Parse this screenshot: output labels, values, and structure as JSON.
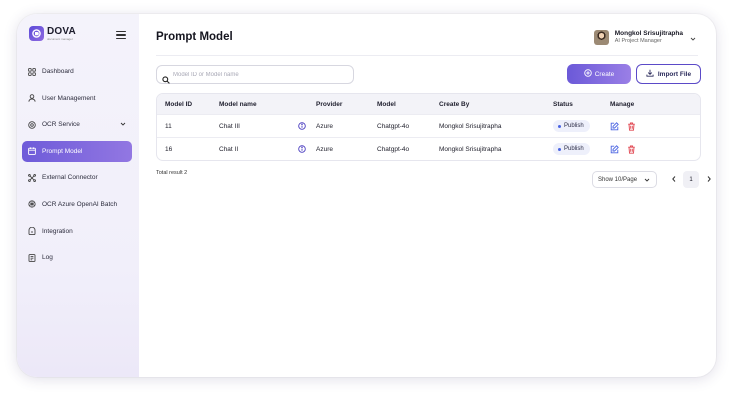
{
  "brand": {
    "name": "DOVA",
    "tagline": "document manager"
  },
  "sidebar": {
    "items": [
      {
        "label": "Dashboard",
        "icon": "grid-icon",
        "active": false
      },
      {
        "label": "User Management",
        "icon": "user-icon",
        "active": false
      },
      {
        "label": "OCR Service",
        "icon": "target-icon",
        "active": false,
        "has_submenu": true
      },
      {
        "label": "Prompt Model",
        "icon": "calendar-icon",
        "active": true
      },
      {
        "label": "External Connector",
        "icon": "connector-icon",
        "active": false
      },
      {
        "label": "OCR Azure OpenAI Batch",
        "icon": "openai-icon",
        "active": false
      },
      {
        "label": "Integration",
        "icon": "integration-icon",
        "active": false
      },
      {
        "label": "Log",
        "icon": "log-icon",
        "active": false
      }
    ]
  },
  "header": {
    "title": "Prompt Model",
    "user": {
      "name": "Mongkol Srisujitrapha",
      "role": "AI Project Manager"
    }
  },
  "toolbar": {
    "search_placeholder": "Model ID or Model name",
    "create_label": "Create",
    "import_label": "Import File"
  },
  "table": {
    "columns": [
      "Model ID",
      "Model name",
      "Provider",
      "Model",
      "Create By",
      "Status",
      "Manage"
    ],
    "rows": [
      {
        "id": "11",
        "name": "Chat III",
        "provider": "Azure",
        "model": "Chatgpt-4o",
        "created_by": "Mongkol Srisujitrapha",
        "status": "Publish"
      },
      {
        "id": "16",
        "name": "Chat II",
        "provider": "Azure",
        "model": "Chatgpt-4o",
        "created_by": "Mongkol Srisujitrapha",
        "status": "Publish"
      }
    ]
  },
  "footer": {
    "total": "Total result 2",
    "page_size": "Show 10/Page",
    "current_page": "1"
  },
  "colors": {
    "accent": "#7563dc",
    "accent_end": "#9a7fe6",
    "status_dot": "#4a64e2",
    "edit_icon": "#4a64e2",
    "delete_icon": "#e0434e"
  }
}
